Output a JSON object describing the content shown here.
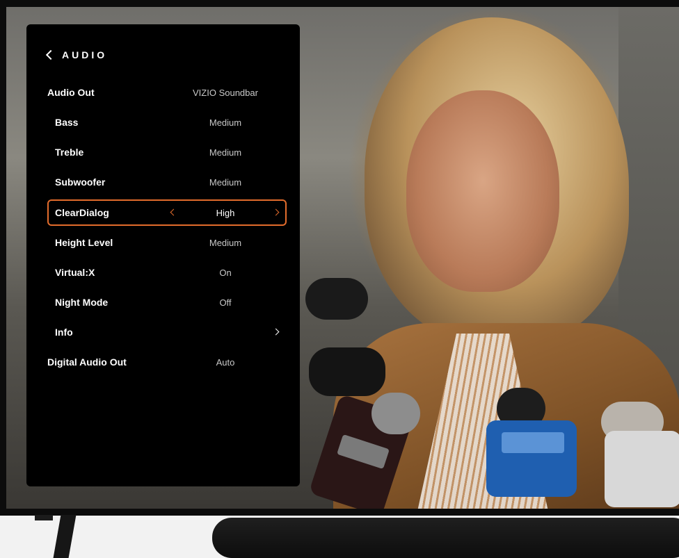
{
  "menu": {
    "title": "AUDIO",
    "back_icon": "chevron-left-icon",
    "items": [
      {
        "label": "Audio Out",
        "value": "VIZIO Soundbar"
      },
      {
        "label": "Bass",
        "value": "Medium"
      },
      {
        "label": "Treble",
        "value": "Medium"
      },
      {
        "label": "Subwoofer",
        "value": "Medium"
      },
      {
        "label": "ClearDialog",
        "value": "High",
        "selected": true
      },
      {
        "label": "Height Level",
        "value": "Medium"
      },
      {
        "label": "Virtual:X",
        "value": "On"
      },
      {
        "label": "Night Mode",
        "value": "Off"
      },
      {
        "label": "Info",
        "value": ""
      },
      {
        "label": "Digital Audio Out",
        "value": "Auto"
      }
    ]
  },
  "colors": {
    "menu_background": "#000000",
    "highlight": "#e36c2c",
    "text": "#ffffff",
    "value_text": "#c9c9c9"
  }
}
